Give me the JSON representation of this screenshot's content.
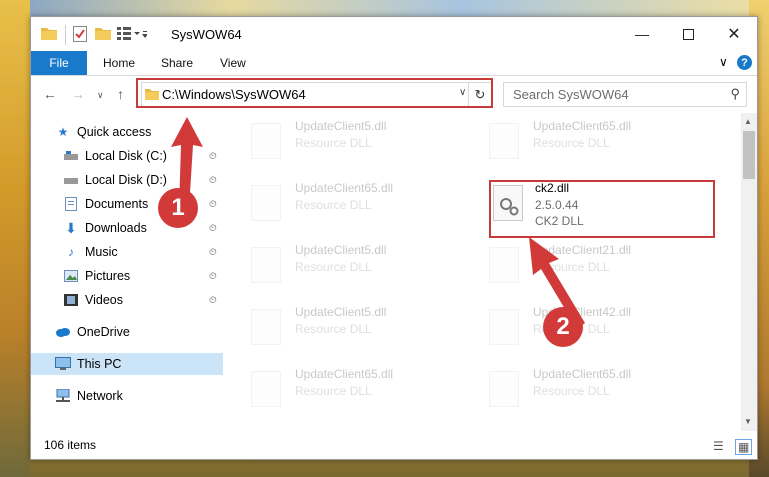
{
  "window": {
    "title": "SysWOW64"
  },
  "ribbon": {
    "file": "File",
    "home": "Home",
    "share": "Share",
    "view": "View",
    "help": "?"
  },
  "nav": {
    "address": "C:\\Windows\\SysWOW64",
    "search_placeholder": "Search SysWOW64"
  },
  "sidebar": {
    "items": [
      {
        "label": "Quick access"
      },
      {
        "label": "Local Disk (C:)"
      },
      {
        "label": "Local Disk (D:)"
      },
      {
        "label": "Documents"
      },
      {
        "label": "Downloads"
      },
      {
        "label": "Music"
      },
      {
        "label": "Pictures"
      },
      {
        "label": "Videos"
      },
      {
        "label": "OneDrive"
      },
      {
        "label": "This PC"
      },
      {
        "label": "Network"
      }
    ]
  },
  "files": [
    {
      "name": "UpdateClient5.dll",
      "type": "Resource DLL"
    },
    {
      "name": "UpdateClient65.dll",
      "type": "Resource DLL"
    },
    {
      "name": "UpdateClient65.dll",
      "type": "Resource DLL"
    },
    {
      "name": "ck2.dll",
      "version": "2.5.0.44",
      "type": "CK2 DLL"
    },
    {
      "name": "UpdateClient5.dll",
      "type": "Resource DLL"
    },
    {
      "name": "UpdateClient21.dll",
      "type": "Resource DLL"
    },
    {
      "name": "UpdateClient5.dll",
      "type": "Resource DLL"
    },
    {
      "name": "UpdateClient42.dll",
      "type": "Resource DLL"
    },
    {
      "name": "UpdateClient65.dll",
      "type": "Resource DLL"
    },
    {
      "name": "UpdateClient65.dll",
      "type": "Resource DLL"
    }
  ],
  "status": {
    "item_count": "106 items"
  },
  "callouts": {
    "step1": "1",
    "step2": "2"
  },
  "colors": {
    "accent": "#1979ca",
    "highlight": "#c73a3a",
    "selected": "#cce4f7"
  }
}
